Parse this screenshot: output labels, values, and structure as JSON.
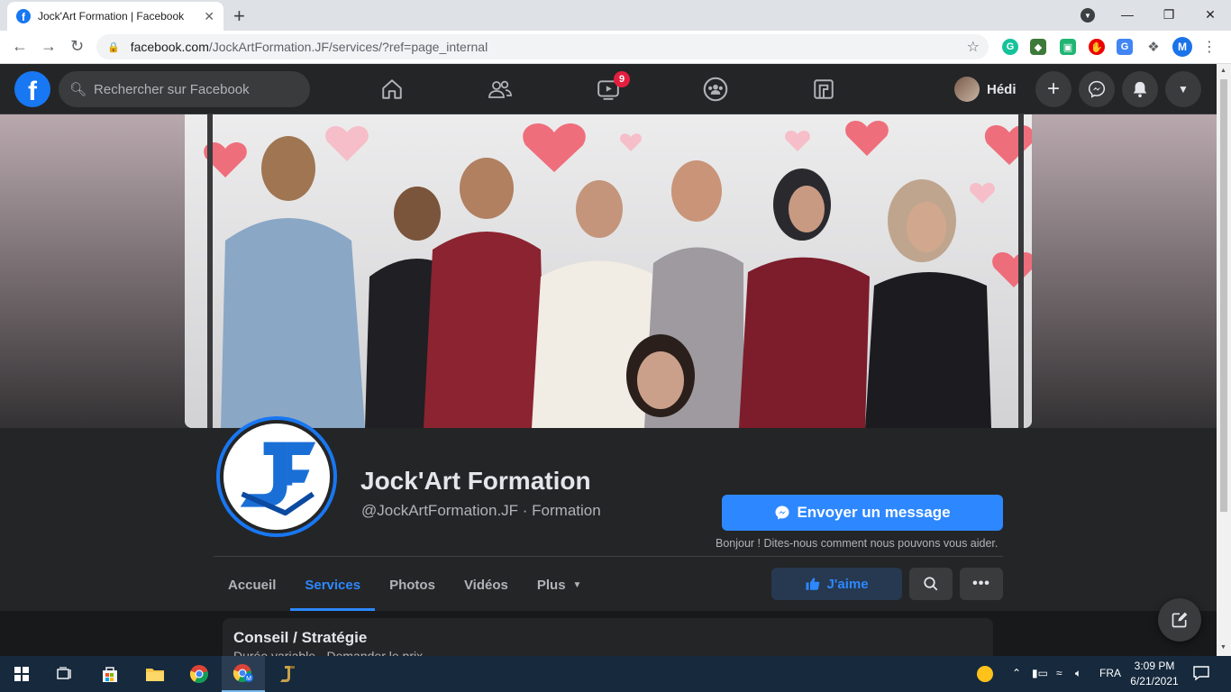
{
  "browser": {
    "tab_title": "Jock'Art Formation | Facebook",
    "tab_close": "✕",
    "new_tab": "+",
    "url_host": "facebook.com",
    "url_path": "/JockArtFormation.JF/services/?ref=page_internal",
    "profile_initial": "M"
  },
  "facebook_nav": {
    "search_placeholder": "Rechercher sur Facebook",
    "watch_badge": "9",
    "user_name": "Hédi"
  },
  "page": {
    "name": "Jock'Art Formation",
    "subtitle": "@JockArtFormation.JF · Formation",
    "message_button": "Envoyer un message",
    "message_hint": "Bonjour ! Dites-nous comment nous pouvons vous aider.",
    "like_button": "J'aime",
    "tabs": [
      {
        "label": "Accueil"
      },
      {
        "label": "Services"
      },
      {
        "label": "Photos"
      },
      {
        "label": "Vidéos"
      },
      {
        "label": "Plus"
      }
    ],
    "active_tab": "Services"
  },
  "service_card": {
    "title": "Conseil / Stratégie",
    "subtitle": "Durée variable · Demander le prix"
  },
  "taskbar": {
    "language": "FRA",
    "time": "3:09 PM",
    "date": "6/21/2021"
  },
  "colors": {
    "fb_blue": "#1877f2",
    "accent_blue": "#2d88ff",
    "surface": "#242526",
    "background": "#18191a",
    "badge_red": "#e41e3f"
  }
}
